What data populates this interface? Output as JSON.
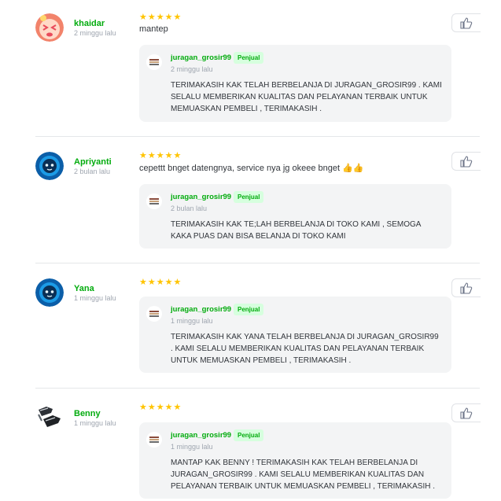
{
  "reviews": [
    {
      "username": "khaidar",
      "time": "2 minggu lalu",
      "stars": "★★★★★",
      "text": "mantep",
      "reply": {
        "shop": "juragan_grosir99",
        "badge": "Penjual",
        "time": "2 minggu lalu",
        "text": "TERIMAKASIH KAK TELAH BERBELANJA DI JURAGAN_GROSIR99 . KAMI SELALU MEMBERIKAN KUALITAS DAN PELAYANAN TERBAIK UNTUK MEMUASKAN PEMBELI , TERIMAKASIH ."
      }
    },
    {
      "username": "Apriyanti",
      "time": "2 bulan lalu",
      "stars": "★★★★★",
      "text": "cepettt bnget datengnya, service nya jg okeee bnget 👍👍",
      "reply": {
        "shop": "juragan_grosir99",
        "badge": "Penjual",
        "time": "2 bulan lalu",
        "text": "TERIMAKASIH KAK TE;LAH BERBELANJA DI TOKO KAMI , SEMOGA KAKA PUAS DAN BISA BELANJA DI TOKO KAMI"
      }
    },
    {
      "username": "Yana",
      "time": "1 minggu lalu",
      "stars": "★★★★★",
      "text": "",
      "reply": {
        "shop": "juragan_grosir99",
        "badge": "Penjual",
        "time": "1 minggu lalu",
        "text": "TERIMAKASIH KAK YANA TELAH BERBELANJA DI JURAGAN_GROSIR99 . KAMI SELALU MEMBERIKAN KUALITAS DAN PELAYANAN TERBAIK UNTUK MEMUASKAN PEMBELI , TERIMAKASIH ."
      }
    },
    {
      "username": "Benny",
      "time": "1 minggu lalu",
      "stars": "★★★★★",
      "text": "",
      "reply": {
        "shop": "juragan_grosir99",
        "badge": "Penjual",
        "time": "1 minggu lalu",
        "text": "MANTAP KAK BENNY ! TERIMAKASIH KAK TELAH BERBELANJA DI JURAGAN_GROSIR99 . KAMI SELALU MEMBERIKAN KUALITAS DAN PELAYANAN TERBAIK UNTUK MEMUASKAN PEMBELI , TERIMAKASIH ."
      }
    }
  ],
  "icons": {
    "like": "thumbs-up-icon",
    "star": "star-icon"
  },
  "colors": {
    "brand_green": "#03ac0e",
    "star": "#ffc400",
    "reply_bg": "#f3f4f5",
    "badge_bg": "#d6ffde"
  }
}
